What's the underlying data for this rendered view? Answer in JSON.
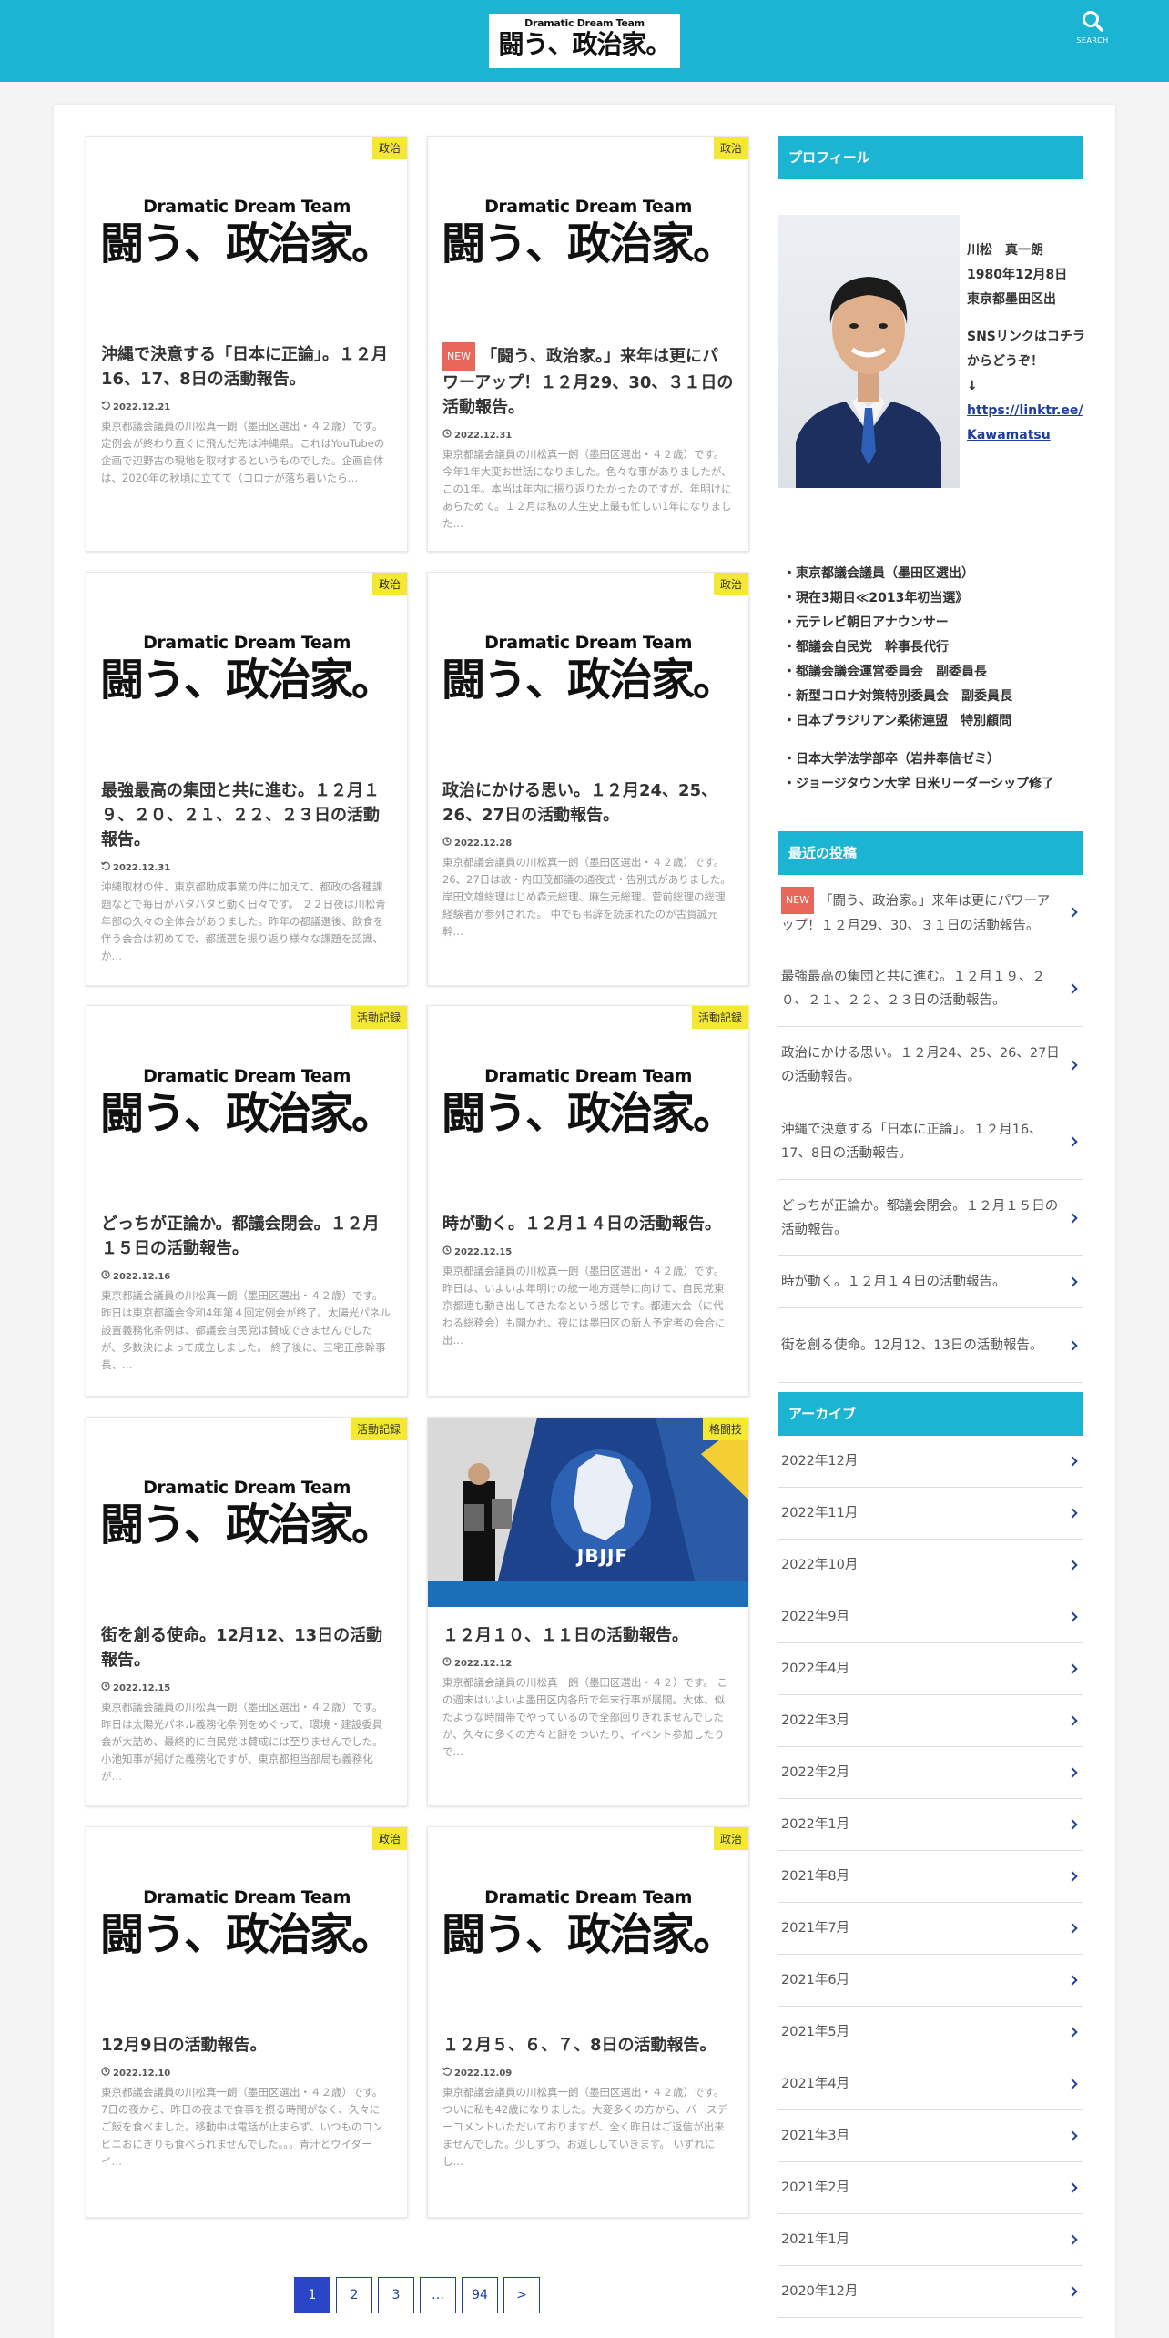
{
  "header": {
    "logo_line1": "Dramatic Dream Team",
    "logo_line2": "闘う、政治家。",
    "search_label": "SEARCH"
  },
  "posts": [
    {
      "category": "政治",
      "title": "沖縄で決意する「日本に正論」。１２月16、17、8日の活動報告。",
      "date": "2022.12.21",
      "date_icon": "refresh-icon",
      "excerpt": "東京都議会議員の川松真一朗（墨田区選出・４２歳）です。 定例会が終わり直ぐに飛んだ先は沖縄県。これはYouTubeの企画で辺野古の現地を取材するというものでした。企画自体は、2020年の秋頃に立てて（コロナが落ち着いたら…"
    },
    {
      "category": "政治",
      "new": "NEW",
      "title": "「闘う、政治家。」来年は更にパワーアップ！１２月29、30、３１日の活動報告。",
      "date": "2022.12.31",
      "date_icon": "clock-icon",
      "excerpt": "東京都議会議員の川松真一朗（墨田区選出・４２歳）です。 今年1年大変お世話になりました。色々な事がありましたが、この1年。本当は年内に振り返りたかったのですが、年明けにあらためて。１２月は私の人生史上最も忙しい1年になりました…"
    },
    {
      "category": "政治",
      "title": "最強最高の集団と共に進む。１２月１９、２０、２１、２２、２３日の活動報告。",
      "date": "2022.12.31",
      "date_icon": "refresh-icon",
      "excerpt": "沖縄取材の件、東京都助成事業の件に加えて、都政の各種課題などで毎日がバタバタと動く日々です。 ２２日夜は川松青年部の久々の全体会がありました。昨年の都議選後、飲食を伴う会合は初めてで、都議選を振り返り様々な課題を認識、か…"
    },
    {
      "category": "政治",
      "title": "政治にかける思い。１２月24、25、26、27日の活動報告。",
      "date": "2022.12.28",
      "date_icon": "clock-icon",
      "excerpt": "東京都議会議員の川松真一朗（墨田区選出・４２歳）です。 26、27日は故・内田茂都議の通夜式・告別式がありました。岸田文雄総理はじめ森元総理、麻生元総理、菅前総理の総理経験者が参列された。 中でも弔辞を読まれたのが古賀誠元幹…"
    },
    {
      "category": "活動記録",
      "title": "どっちが正論か。都議会閉会。１２月１５日の活動報告。",
      "date": "2022.12.16",
      "date_icon": "clock-icon",
      "excerpt": "東京都議会議員の川松真一朗（墨田区選出・４２歳）です。 昨日は東京都議会令和4年第４回定例会が終了。太陽光パネル設置義務化条例は、都議会自民党は賛成できませんでしたが、多数決によって成立しました。 終了後に、三宅正彦幹事長、…"
    },
    {
      "category": "活動記録",
      "title": "時が動く。１２月１４日の活動報告。",
      "date": "2022.12.15",
      "date_icon": "clock-icon",
      "excerpt": "東京都議会議員の川松真一朗（墨田区選出・４２歳）です。 昨日は、いよいよ年明けの統一地方選挙に向けて、自民党東京都連も動き出してきたなという感じです。都連大会（に代わる総務会）も開かれ、夜には墨田区の新人予定者の会合に出…"
    },
    {
      "category": "活動記録",
      "title": "街を創る使命。12月12、13日の活動報告。",
      "date": "2022.12.15",
      "date_icon": "clock-icon",
      "excerpt": "東京都議会議員の川松真一朗（墨田区選出・４２歳）です。 昨日は太陽光パネル義務化条例をめぐって、環境・建設委員会が大詰め、最終的に自民党は賛成には至りませんでした。 小池知事が掲げた義務化ですが、東京都担当部局も義務化が…"
    },
    {
      "category": "格闘技",
      "photo": true,
      "title": "１２月１０、１１日の活動報告。",
      "date": "2022.12.12",
      "date_icon": "clock-icon",
      "excerpt": "東京都議会議員の川松真一朗（墨田区選出・４２）です。 この週末はいよいよ墨田区内各所で年末行事が展開。大体、似たような時間帯でやっているので全部回りきれませんでしたが、久々に多くの方々と餅をついたり、イベント参加したりで…"
    },
    {
      "category": "政治",
      "title": "12月9日の活動報告。",
      "date": "2022.12.10",
      "date_icon": "clock-icon",
      "excerpt": "東京都議会議員の川松真一朗（墨田区選出・４２歳）です。 7日の夜から、昨日の夜まで食事を摂る時間がなく、久々に ご飯を食べました。移動中は電話が止まらず、いつものコンビニおにぎりも食べられませんでした。。。青汁とウイダーイ…"
    },
    {
      "category": "政治",
      "title": "１２月５、６、７、8日の活動報告。",
      "date": "2022.12.09",
      "date_icon": "refresh-icon",
      "excerpt": "東京都議会議員の川松真一朗（墨田区選出・４２歳）です。ついに私も42歳になりました。大変多くの方から、バースデーコメントいただいておりますが、全く昨日はご返信が出来ませんでした。少しずつ、お返ししていきます。 いずれにし…"
    }
  ],
  "photo_caption": "JBJJF",
  "pagination": [
    "1",
    "2",
    "3",
    "…",
    "94",
    ">"
  ],
  "sidebar": {
    "profile_heading": "プロフィール",
    "profile": {
      "name": "川松　真一朗",
      "birth": "1980年12月8日",
      "area": "東京都墨田区出",
      "sns": "SNSリンクはコチラからどうぞ！",
      "arrow": "↓",
      "link": "https://linktr.ee/Kawamatsu"
    },
    "career": [
      "・東京都議会議員（墨田区選出）",
      "・現在3期目≪2013年初当選》",
      "・元テレビ朝日アナウンサー",
      "・都議会自民党　幹事長代行",
      "・都議会議会運営委員会　副委員長",
      "・新型コロナ対策特別委員会　副委員長",
      "・日本ブラジリアン柔術連盟　特別顧問"
    ],
    "education": [
      "・日本大学法学部卒（岩井奉信ゼミ）",
      "・ジョージタウン大学 日米リーダーシップ修了"
    ],
    "recent_heading": "最近の投稿",
    "recent": [
      {
        "new": "NEW",
        "title": "「闘う、政治家。」来年は更にパワーアップ！１２月29、30、３１日の活動報告。"
      },
      {
        "title": "最強最高の集団と共に進む。１２月１９、２０、２１、２２、２３日の活動報告。"
      },
      {
        "title": "政治にかける思い。１２月24、25、26、27日の活動報告。"
      },
      {
        "title": "沖縄で決意する「日本に正論」。１２月16、17、8日の活動報告。"
      },
      {
        "title": "どっちが正論か。都議会閉会。１２月１５日の活動報告。"
      },
      {
        "title": "時が動く。１２月１４日の活動報告。"
      },
      {
        "title": "街を創る使命。12月12、13日の活動報告。"
      }
    ],
    "archive_heading": "アーカイブ",
    "archives": [
      "2022年12月",
      "2022年11月",
      "2022年10月",
      "2022年9月",
      "2022年4月",
      "2022年3月",
      "2022年2月",
      "2022年1月",
      "2021年8月",
      "2021年7月",
      "2021年6月",
      "2021年5月",
      "2021年4月",
      "2021年3月",
      "2021年2月",
      "2021年1月",
      "2020年12月"
    ]
  }
}
